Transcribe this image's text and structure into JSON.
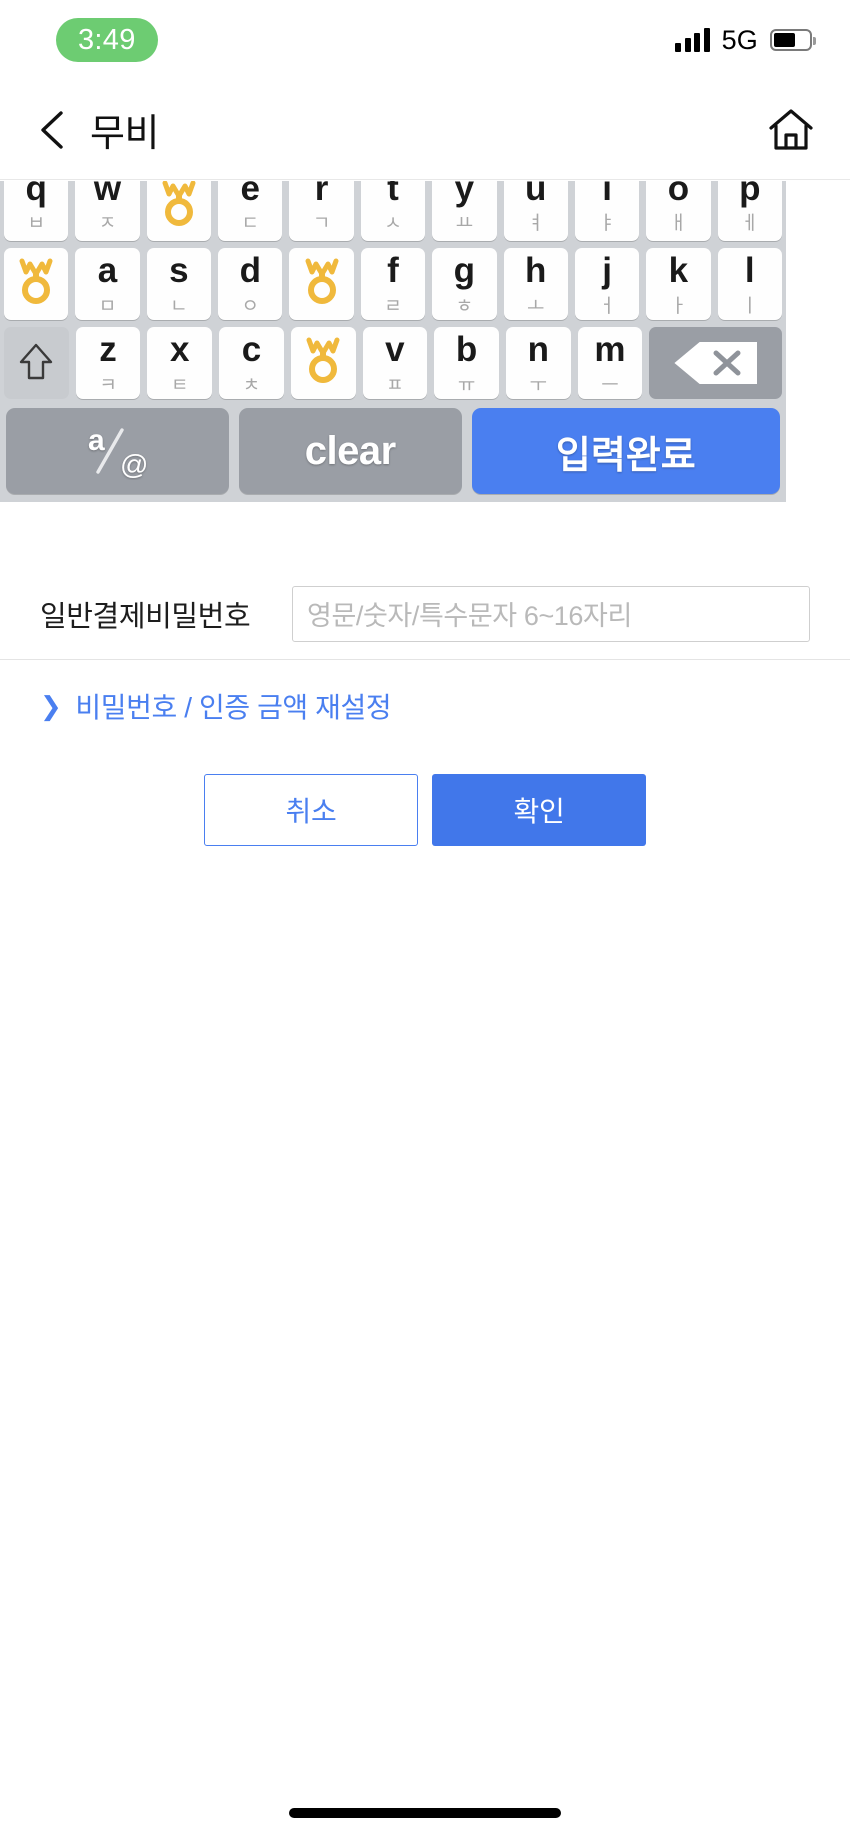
{
  "statusbar": {
    "time": "3:49",
    "network": "5G",
    "signal_icon": "signal-bars-icon",
    "battery_icon": "battery-icon",
    "time_pill_color": "#6dcc72"
  },
  "header": {
    "back_icon": "chevron-left-icon",
    "title": "무비",
    "home_icon": "home-icon"
  },
  "keyboard": {
    "type": "secure-qwerty-korean",
    "masked_glyph_name": "masked-key-glyph",
    "masked_glyph_color": "#f0b93c",
    "rows": [
      {
        "name": "keyboard-row-1",
        "keys": [
          {
            "main": "q",
            "sub": "ㅂ",
            "masked": false
          },
          {
            "main": "w",
            "sub": "ㅈ",
            "masked": false
          },
          {
            "main": "",
            "sub": "",
            "masked": true
          },
          {
            "main": "e",
            "sub": "ㄷ",
            "masked": false
          },
          {
            "main": "r",
            "sub": "ㄱ",
            "masked": false
          },
          {
            "main": "t",
            "sub": "ㅅ",
            "masked": false
          },
          {
            "main": "y",
            "sub": "ㅛ",
            "masked": false
          },
          {
            "main": "u",
            "sub": "ㅕ",
            "masked": false
          },
          {
            "main": "i",
            "sub": "ㅑ",
            "masked": false
          },
          {
            "main": "o",
            "sub": "ㅐ",
            "masked": false
          },
          {
            "main": "p",
            "sub": "ㅔ",
            "masked": false
          }
        ]
      },
      {
        "name": "keyboard-row-2",
        "keys": [
          {
            "main": "",
            "sub": "",
            "masked": true
          },
          {
            "main": "a",
            "sub": "ㅁ",
            "masked": false
          },
          {
            "main": "s",
            "sub": "ㄴ",
            "masked": false
          },
          {
            "main": "d",
            "sub": "ㅇ",
            "masked": false
          },
          {
            "main": "",
            "sub": "",
            "masked": true
          },
          {
            "main": "f",
            "sub": "ㄹ",
            "masked": false
          },
          {
            "main": "g",
            "sub": "ㅎ",
            "masked": false
          },
          {
            "main": "h",
            "sub": "ㅗ",
            "masked": false
          },
          {
            "main": "j",
            "sub": "ㅓ",
            "masked": false
          },
          {
            "main": "k",
            "sub": "ㅏ",
            "masked": false
          },
          {
            "main": "l",
            "sub": "ㅣ",
            "masked": false
          }
        ]
      },
      {
        "name": "keyboard-row-3",
        "keys": [
          {
            "main": "z",
            "sub": "ㅋ",
            "masked": false
          },
          {
            "main": "x",
            "sub": "ㅌ",
            "masked": false
          },
          {
            "main": "c",
            "sub": "ㅊ",
            "masked": false
          },
          {
            "main": "",
            "sub": "",
            "masked": true
          },
          {
            "main": "v",
            "sub": "ㅍ",
            "masked": false
          },
          {
            "main": "b",
            "sub": "ㅠ",
            "masked": false
          },
          {
            "main": "n",
            "sub": "ㅜ",
            "masked": false
          },
          {
            "main": "m",
            "sub": "ㅡ",
            "masked": false
          }
        ],
        "shift_icon": "shift-arrow-icon",
        "backspace_icon": "backspace-icon"
      }
    ],
    "function_row": {
      "alt_label": "a/@",
      "alt_icon": "alpha-symbol-toggle-icon",
      "clear_label": "clear",
      "done_label": "입력완료",
      "done_color": "#4a7ff0"
    }
  },
  "form": {
    "password_label": "일반결제비밀번호",
    "password_value": "",
    "password_placeholder": "영문/숫자/특수문자 6~16자리",
    "reset_link_label": "비밀번호 / 인증 금액 재설정",
    "reset_link_icon": "chevron-right-icon",
    "cancel_label": "취소",
    "confirm_label": "확인",
    "accent_color": "#4a7ff0"
  }
}
